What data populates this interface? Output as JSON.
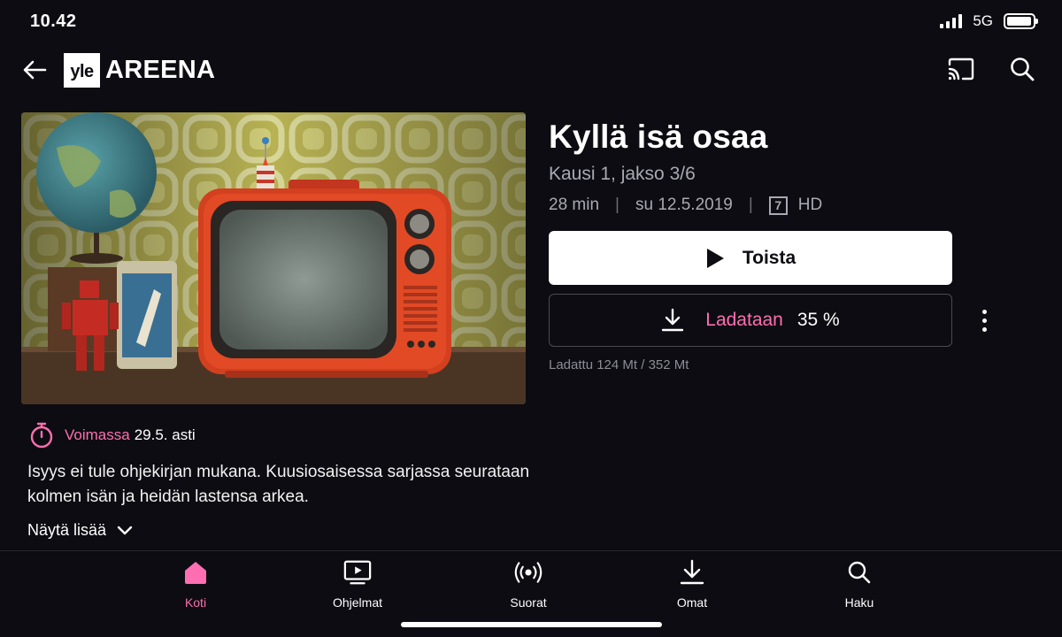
{
  "status_bar": {
    "time": "10.42",
    "network": "5G",
    "battery_level": 0.95
  },
  "header": {
    "logo_box": "yle",
    "logo_text": "AREENA",
    "icons": [
      "back-arrow-icon",
      "cast-icon",
      "search-icon"
    ]
  },
  "program": {
    "title": "Kyllä isä osaa",
    "subtitle": "Kausi 1, jakso 3/6",
    "duration": "28 min",
    "date": "su 12.5.2019",
    "age_rating": "7",
    "quality": "HD",
    "thumbnail": "retro-tv-still"
  },
  "actions": {
    "play_label": "Toista",
    "download_label": "Ladataan",
    "download_percent": "35 %",
    "download_progress": "Ladattu 124 Mt / 352 Mt"
  },
  "validity": {
    "label": "Voimassa",
    "date": "29.5. asti"
  },
  "description": "Isyys ei tule ohjekirjan mukana. Kuusiosaisessa sarjassa seurataan kolmen isän ja heidän lastensa arkea.",
  "show_more_label": "Näytä lisää",
  "bottom_nav": {
    "items": [
      {
        "label": "Koti",
        "icon": "home-icon",
        "active": true
      },
      {
        "label": "Ohjelmat",
        "icon": "tv-play-icon",
        "active": false
      },
      {
        "label": "Suorat",
        "icon": "live-broadcast-icon",
        "active": false
      },
      {
        "label": "Omat",
        "icon": "download-icon",
        "active": false
      },
      {
        "label": "Haku",
        "icon": "search-icon",
        "active": false
      }
    ]
  },
  "colors": {
    "background": "#0c0c12",
    "accent": "#ff6eb0",
    "muted_text": "#a9a9b3"
  }
}
